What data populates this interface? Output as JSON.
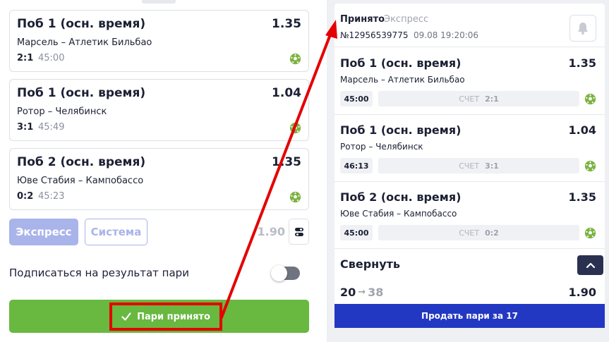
{
  "colors": {
    "accent_green": "#69b840",
    "annotation_red": "#e40000",
    "brand_blue": "#2338c2",
    "express_lilac": "#a9b4ea"
  },
  "left_panel": {
    "selections": [
      {
        "market": "Поб 1 (осн. время)",
        "odds": "1.35",
        "teams": "Марсель – Атлетик Бильбао",
        "score": "2:1",
        "time": "45:00",
        "icon": "soccer-ball-icon"
      },
      {
        "market": "Поб 1 (осн. время)",
        "odds": "1.04",
        "teams": "Ротор – Челябинск",
        "score": "3:1",
        "time": "45:49",
        "icon": "soccer-ball-icon"
      },
      {
        "market": "Поб 2 (осн. время)",
        "odds": "1.35",
        "teams": "Юве Стабия – Кампобассо",
        "score": "0:2",
        "time": "45:23",
        "icon": "soccer-ball-icon"
      }
    ],
    "mode_express": "Экспресс",
    "mode_system": "Система",
    "total_odds": "1.90",
    "settings_icon": "sliders-icon",
    "subscribe_label": "Подписаться на результат пари",
    "subscribe_enabled": false,
    "accept_label": "Пари принято",
    "accept_icon": "checkmark-icon"
  },
  "receipt": {
    "status": "Принято",
    "type": "Экспресс",
    "number": "№12956539775",
    "datetime": "09.08 19:20:06",
    "bell_icon": "bell-icon",
    "events": [
      {
        "market": "Поб 1 (осн. время)",
        "odds": "1.35",
        "teams": "Марсель – Атлетик Бильбао",
        "time": "45:00",
        "score_label": "СЧЕТ",
        "score": "2:1",
        "icon": "soccer-ball-icon"
      },
      {
        "market": "Поб 1 (осн. время)",
        "odds": "1.04",
        "teams": "Ротор – Челябинск",
        "time": "46:13",
        "score_label": "СЧЕТ",
        "score": "3:1",
        "icon": "soccer-ball-icon"
      },
      {
        "market": "Поб 2 (осн. время)",
        "odds": "1.35",
        "teams": "Юве Стабия – Кампобассо",
        "time": "45:00",
        "score_label": "СЧЕТ",
        "score": "0:2",
        "icon": "soccer-ball-icon"
      }
    ],
    "collapse_label": "Свернуть",
    "collapse_icon": "chevron-up-icon",
    "stake": "20",
    "arrow": "→",
    "payout": "38",
    "total_odds": "1.90",
    "sell_label": "Продать пари за 17"
  }
}
